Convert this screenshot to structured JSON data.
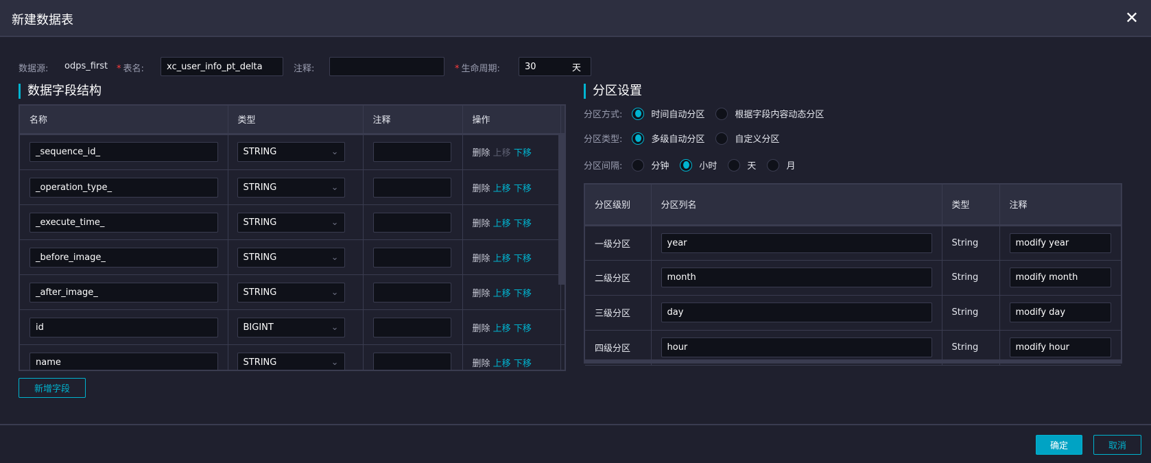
{
  "dialog": {
    "title": "新建数据表",
    "close_icon": "close-icon"
  },
  "form": {
    "datasource_label": "数据源:",
    "datasource_value": "odps_first",
    "table_name_label": "表名:",
    "table_name_value": "xc_user_info_pt_delta",
    "comment_label": "注释:",
    "comment_value": "",
    "lifecycle_label": "生命周期:",
    "lifecycle_value": "30",
    "lifecycle_unit": "天",
    "required_mark": "*"
  },
  "fields": {
    "title": "数据字段结构",
    "columns": [
      "名称",
      "类型",
      "注释",
      "操作"
    ],
    "rows": [
      {
        "name": "_sequence_id_",
        "type": "STRING",
        "comment": "",
        "up_disabled": true
      },
      {
        "name": "_operation_type_",
        "type": "STRING",
        "comment": "",
        "up_disabled": false
      },
      {
        "name": "_execute_time_",
        "type": "STRING",
        "comment": "",
        "up_disabled": false
      },
      {
        "name": "_before_image_",
        "type": "STRING",
        "comment": "",
        "up_disabled": false
      },
      {
        "name": "_after_image_",
        "type": "STRING",
        "comment": "",
        "up_disabled": false
      },
      {
        "name": "id",
        "type": "BIGINT",
        "comment": "",
        "up_disabled": false
      },
      {
        "name": "name",
        "type": "STRING",
        "comment": "",
        "up_disabled": false
      }
    ],
    "actions": {
      "delete": "删除",
      "up": "上移",
      "down": "下移"
    },
    "add_button": "新增字段"
  },
  "partition": {
    "title": "分区设置",
    "method": {
      "label": "分区方式:",
      "options": [
        "时间自动分区",
        "根据字段内容动态分区"
      ],
      "selected": 0
    },
    "type": {
      "label": "分区类型:",
      "options": [
        "多级自动分区",
        "自定义分区"
      ],
      "selected": 0
    },
    "interval": {
      "label": "分区间隔:",
      "options": [
        "分钟",
        "小时",
        "天",
        "月"
      ],
      "selected": 1
    },
    "columns": [
      "分区级别",
      "分区列名",
      "类型",
      "注释"
    ],
    "rows": [
      {
        "level": "一级分区",
        "name": "year",
        "type": "String",
        "comment": "modify year"
      },
      {
        "level": "二级分区",
        "name": "month",
        "type": "String",
        "comment": "modify month"
      },
      {
        "level": "三级分区",
        "name": "day",
        "type": "String",
        "comment": "modify day"
      },
      {
        "level": "四级分区",
        "name": "hour",
        "type": "String",
        "comment": "modify hour"
      }
    ]
  },
  "footer": {
    "ok": "确定",
    "cancel": "取消"
  },
  "colors": {
    "accent": "#00b4d0",
    "background": "#1f202e",
    "header": "#2d2f40"
  }
}
